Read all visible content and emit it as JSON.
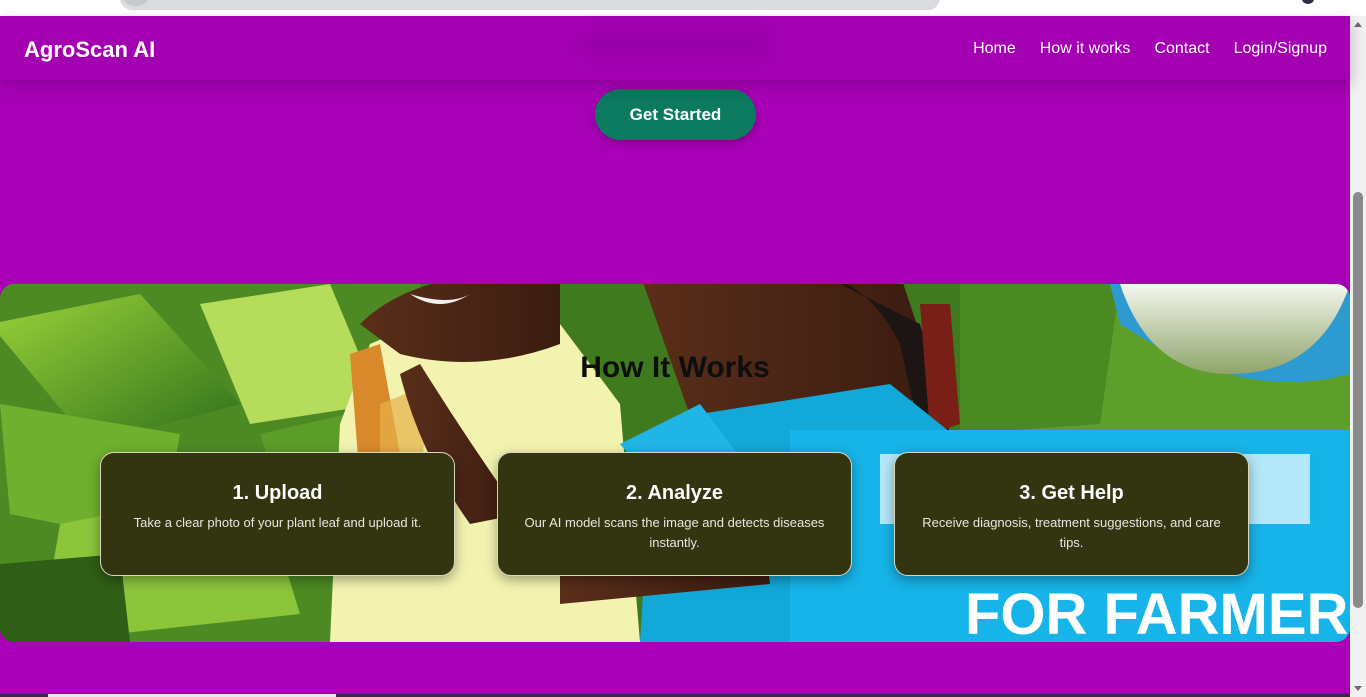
{
  "app": {
    "brand": "AgroScan AI",
    "accent_color": "#a800b7",
    "button_color": "#0b7a5e",
    "card_color": "#333410"
  },
  "nav": {
    "items": [
      {
        "label": "Home"
      },
      {
        "label": "How it works"
      },
      {
        "label": "Contact"
      },
      {
        "label": "Login/Signup"
      }
    ]
  },
  "hero": {
    "cta_label": "Get Started"
  },
  "how_it_works": {
    "title": "How It Works",
    "background_image": "photo of two smiling women farmers among green plants with a blue banner",
    "banner_text": "FOR FARMERS",
    "steps": [
      {
        "title": "1. Upload",
        "text": "Take a clear photo of your plant leaf and upload it."
      },
      {
        "title": "2. Analyze",
        "text": "Our AI model scans the image and detects diseases instantly."
      },
      {
        "title": "3. Get Help",
        "text": "Receive diagnosis, treatment suggestions, and care tips."
      }
    ]
  }
}
